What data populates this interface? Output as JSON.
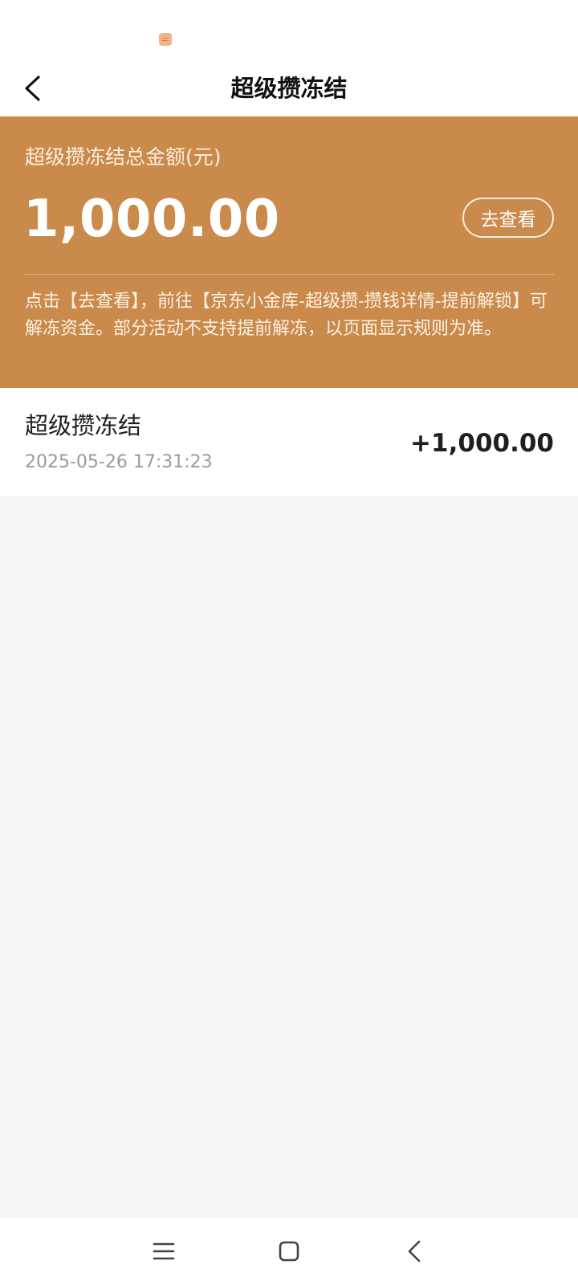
{
  "nav": {
    "title": "超级攒冻结"
  },
  "hero": {
    "label": "超级攒冻结总金额(元)",
    "amount": "1,000.00",
    "view_button": "去查看",
    "note": "点击【去查看】，前往【京东小金库-超级攒-攒钱详情-提前解锁】可解冻资金。部分活动不支持提前解冻，以页面显示规则为准。",
    "background_color": "#c98a4b"
  },
  "records": [
    {
      "title": "超级攒冻结",
      "time": "2025-05-26 17:31:23",
      "amount": "+1,000.00"
    }
  ],
  "icons": {
    "back": "chevron-left-icon",
    "notification": "notification-badge-icon",
    "menu": "menu-icon",
    "home": "home-icon",
    "system_back": "back-icon"
  }
}
